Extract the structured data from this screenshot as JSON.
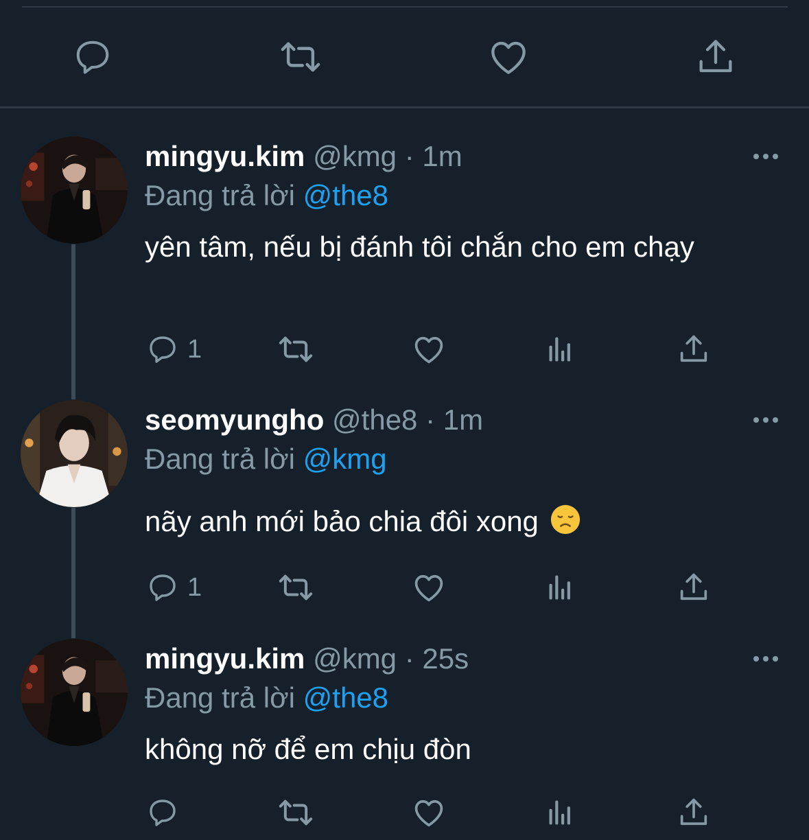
{
  "colors": {
    "background": "#15202b",
    "divider": "#2f3b47",
    "muted": "#8899a6",
    "accent": "#1da1f2",
    "text": "#ffffff"
  },
  "top_actions": {
    "icons": [
      "reply-icon",
      "retweet-icon",
      "like-icon",
      "share-icon"
    ]
  },
  "replies": [
    {
      "display_name": "mingyu.kim",
      "handle": "@kmg",
      "separator": "·",
      "time": "1m",
      "replying_prefix": "Đang trả lời",
      "replying_to": "@the8",
      "text": "yên tâm, nếu bị đánh tôi chắn cho em chạy",
      "reply_count": "1",
      "avatar": "avatar-mingyu"
    },
    {
      "display_name": "seomyungho",
      "handle": "@the8",
      "separator": "·",
      "time": "1m",
      "replying_prefix": "Đang trả lời",
      "replying_to": "@kmg",
      "text": "nãy anh mới bảo chia đôi xong",
      "emoji": "disappointed-face",
      "reply_count": "1",
      "avatar": "avatar-seomyungho"
    },
    {
      "display_name": "mingyu.kim",
      "handle": "@kmg",
      "separator": "·",
      "time": "25s",
      "replying_prefix": "Đang trả lời",
      "replying_to": "@the8",
      "text": "không nỡ để em chịu đòn",
      "reply_count": "",
      "avatar": "avatar-mingyu"
    }
  ]
}
